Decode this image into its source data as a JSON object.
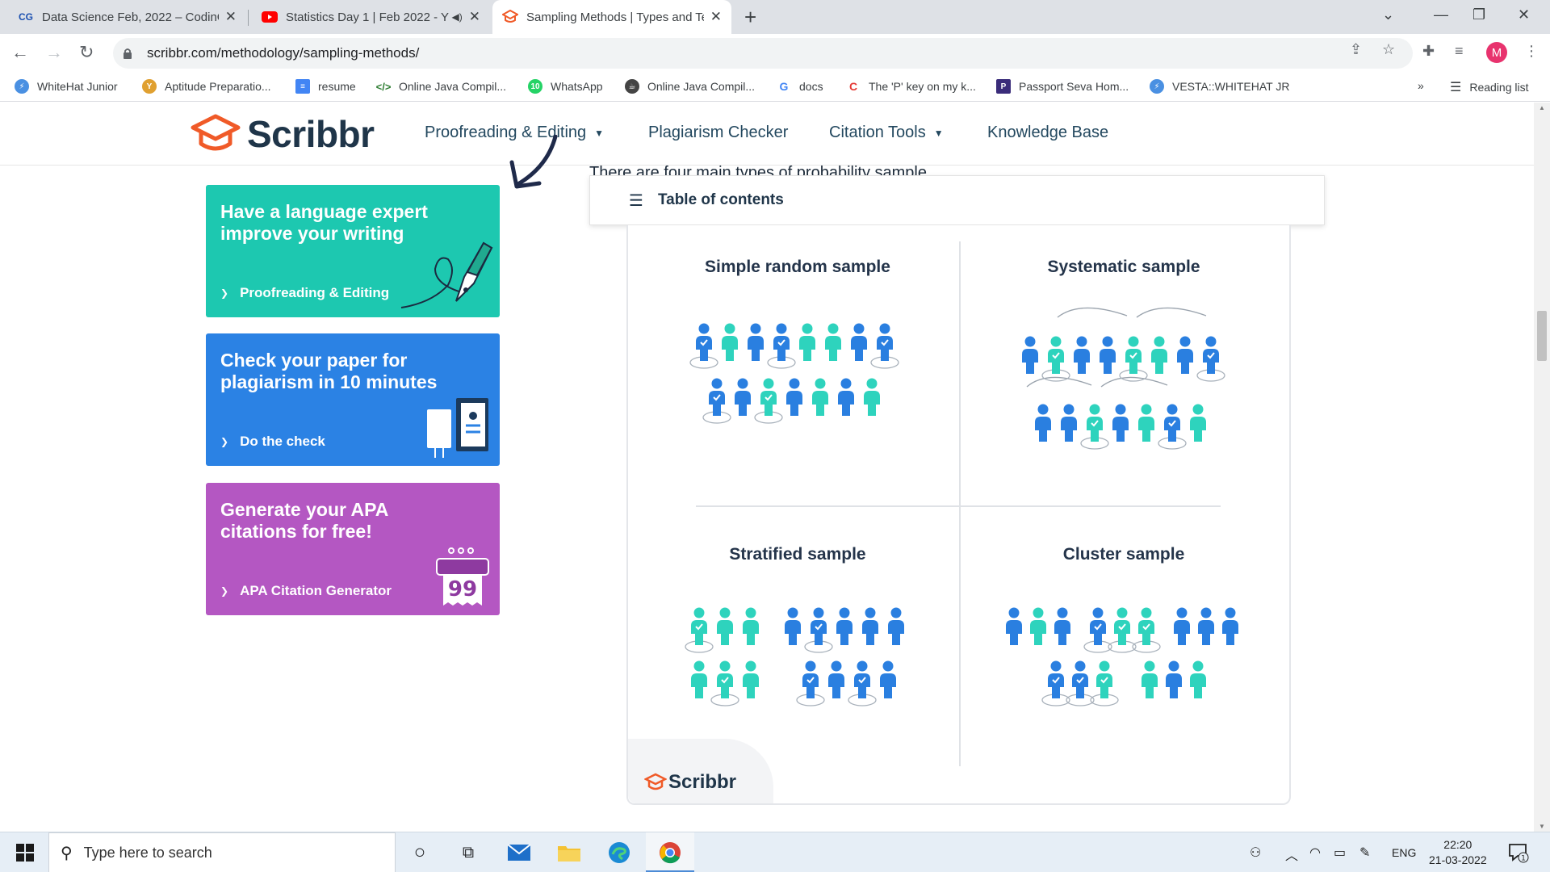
{
  "browser": {
    "tabs": [
      {
        "title": "Data Science Feb, 2022 – CodinG",
        "favicon": "CG",
        "favicon_color": "#1a4fb0"
      },
      {
        "title": "Statistics Day 1 | Feb 2022 - Y",
        "favicon": "youtube-icon",
        "favicon_color": "#ff0000"
      },
      {
        "title": "Sampling Methods | Types and Te",
        "favicon": "scribbr-icon",
        "favicon_color": "#f05a28"
      }
    ],
    "url": "scribbr.com/methodology/sampling-methods/",
    "profile_initial": "M",
    "bookmarks": [
      {
        "label": "WhiteHat Junior",
        "color": "#4a90e2"
      },
      {
        "label": "Aptitude Preparatio...",
        "color": "#e0a030"
      },
      {
        "label": "resume",
        "color": "#4285f4"
      },
      {
        "label": "Online Java Compil...",
        "color": "#2e7d32"
      },
      {
        "label": "WhatsApp",
        "color": "#25d366"
      },
      {
        "label": "Online Java Compil...",
        "color": "#444444"
      },
      {
        "label": "docs",
        "color": "#4285f4"
      },
      {
        "label": "The 'P' key on my k...",
        "color": "#e53935"
      },
      {
        "label": "Passport Seva Hom...",
        "color": "#3a2c7a"
      },
      {
        "label": "VESTA::WHITEHAT JR",
        "color": "#4a90e2"
      }
    ],
    "more_bookmarks": "»",
    "reading_list": "Reading list"
  },
  "site": {
    "brand": "Scribbr",
    "brand_color": "#f05a28",
    "nav": [
      {
        "label": "Proofreading & Editing",
        "has_dropdown": true
      },
      {
        "label": "Plagiarism Checker",
        "has_dropdown": false
      },
      {
        "label": "Citation Tools",
        "has_dropdown": true
      },
      {
        "label": "Knowledge Base",
        "has_dropdown": false
      }
    ]
  },
  "promos": [
    {
      "headline": "Have a language expert improve your writing",
      "link": "Proofreading & Editing",
      "color": "#1dc8b0"
    },
    {
      "headline": "Check your paper for plagiarism in 10 minutes",
      "link": "Do the check",
      "color": "#2b82e4"
    },
    {
      "headline": "Generate your APA citations for free!",
      "link": "APA Citation Generator",
      "color": "#b457c2"
    }
  ],
  "article": {
    "partial_text": "There are four main types of probability sample.",
    "toc_label": "Table of contents"
  },
  "figure": {
    "quadrants": [
      "Simple random sample",
      "Systematic sample",
      "Stratified sample",
      "Cluster sample"
    ],
    "watermark": "Scribbr",
    "colors": {
      "blue": "#2a7fe0",
      "teal": "#2ed3bd"
    }
  },
  "taskbar": {
    "search_placeholder": "Type here to search",
    "language": "ENG",
    "time": "22:20",
    "date": "21-03-2022",
    "notifications": "1"
  }
}
